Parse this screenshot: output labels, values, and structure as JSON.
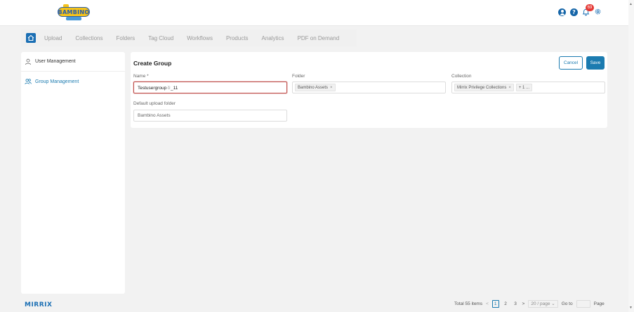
{
  "brand": {
    "logo_text": "BAMBINO",
    "footer_logo_text": "MIRRIX"
  },
  "header": {
    "notification_count": "69"
  },
  "nav": {
    "items": [
      "Upload",
      "Collections",
      "Folders",
      "Tag Cloud",
      "Workflows",
      "Products",
      "Analytics",
      "PDF on Demand"
    ]
  },
  "sidebar": {
    "items": [
      {
        "label": "User Management",
        "icon": "user-icon"
      },
      {
        "label": "Group Management",
        "icon": "users-icon"
      }
    ]
  },
  "form": {
    "title": "Create Group",
    "cancel_label": "Cancel",
    "save_label": "Save",
    "name_label": "Name *",
    "name_value": "Testusergroup☃_11",
    "folder_label": "Folder",
    "folder_tag": "Bambino Assets",
    "collection_label": "Collection",
    "collection_tag": "Mirrix Privilege Collections",
    "collection_more": "+ 1 ...",
    "default_folder_label": "Default upload folder",
    "default_folder_value": "Bambino Assets"
  },
  "pagination": {
    "total": "Total 55 items",
    "pages": [
      "1",
      "2",
      "3"
    ],
    "current": "1",
    "page_size": "20 / page",
    "goto_label": "Go to",
    "page_suffix": "Page"
  },
  "colors": {
    "accent": "#1b7bb0",
    "badge": "#e53935",
    "focus_border": "#c0504d"
  }
}
